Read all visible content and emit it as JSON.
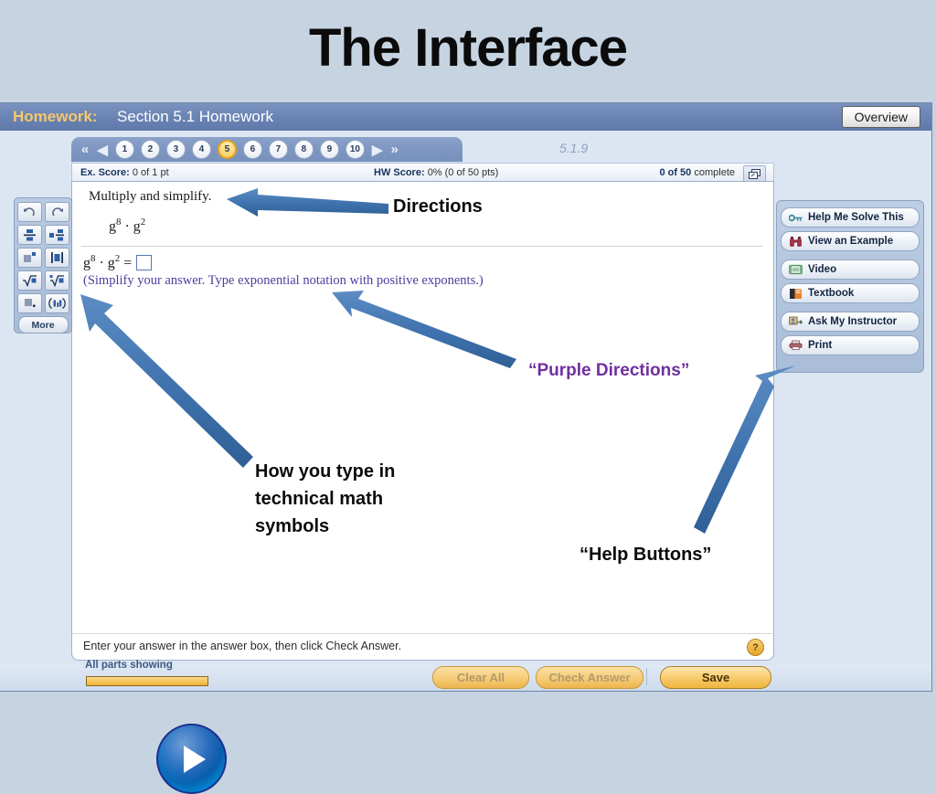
{
  "slide": {
    "title": "The Interface"
  },
  "window": {
    "label": "Homework:",
    "assignment": "Section 5.1 Homework",
    "overview_button": "Overview",
    "version": "5.1.9"
  },
  "navigation": {
    "first_icon": "double-left-arrow",
    "prev_icon": "left-arrow",
    "next_icon": "right-arrow",
    "last_icon": "double-right-arrow",
    "numbers": [
      "1",
      "2",
      "3",
      "4",
      "5",
      "6",
      "7",
      "8",
      "9",
      "10"
    ],
    "active": "5"
  },
  "scores": {
    "ex_label": "Ex. Score:",
    "ex_value": "0 of 1 pt",
    "hw_label": "HW Score:",
    "hw_value": "0% (0 of 50 pts)",
    "complete_value": "0 of 50",
    "complete_label": "complete",
    "popout_icon": "popout-window-icon"
  },
  "problem": {
    "directions": "Multiply and simplify.",
    "expression_base": "g",
    "expression": "g8 · g2",
    "answer_prompt": "g8 · g2 =",
    "answer_value": "",
    "purple_directions": "(Simplify your answer. Type exponential notation with positive exponents.)"
  },
  "instruction_bar": {
    "text": "Enter your answer in the answer box, then click Check Answer.",
    "help_icon": "question-mark-icon"
  },
  "palette": {
    "keys": [
      {
        "name": "undo-icon",
        "label": "undo"
      },
      {
        "name": "redo-icon",
        "label": "redo"
      },
      {
        "name": "fraction-icon",
        "label": "fraction"
      },
      {
        "name": "mixed-number-icon",
        "label": "mixed number"
      },
      {
        "name": "exponent-icon",
        "label": "exponent"
      },
      {
        "name": "absolute-value-icon",
        "label": "absolute value"
      },
      {
        "name": "square-root-icon",
        "label": "square root"
      },
      {
        "name": "nth-root-icon",
        "label": "nth root"
      },
      {
        "name": "decimal-icon",
        "label": "repeating decimal"
      },
      {
        "name": "interval-icon",
        "label": "interval notation"
      }
    ],
    "more_label": "More"
  },
  "help_panel": {
    "buttons": [
      {
        "label": "Help Me Solve This",
        "icon": "key-icon"
      },
      {
        "label": "View an Example",
        "icon": "binoculars-icon"
      },
      {
        "label": "Video",
        "icon": "filmstrip-icon"
      },
      {
        "label": "Textbook",
        "icon": "book-icon"
      },
      {
        "label": "Ask My Instructor",
        "icon": "instructor-icon"
      },
      {
        "label": "Print",
        "icon": "printer-icon"
      }
    ]
  },
  "footer": {
    "parts_label": "All parts showing",
    "clear_all": "Clear All",
    "check_answer": "Check Answer",
    "save": "Save"
  },
  "annotations": {
    "directions": "Directions",
    "purple": "“Purple Directions”",
    "typing": "How you type in technical math symbols",
    "help": "“Help Buttons”"
  },
  "colors": {
    "slide_background": "#c6d4e1",
    "titlebar": "#6b84b4",
    "accent_gold": "#f2b333",
    "purple_text": "#7030a0",
    "arrow_blue": "#3f72ad",
    "purple_directions_text": "#4a3f9e"
  },
  "media": {
    "play_button": "play-button-icon"
  }
}
